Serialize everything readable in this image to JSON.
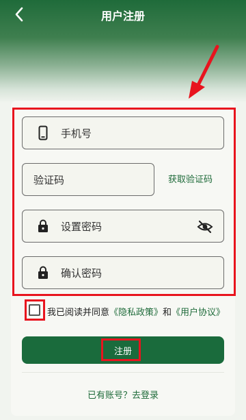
{
  "header": {
    "title": "用户注册",
    "back_icon": "chevron-left-icon"
  },
  "form": {
    "phone_placeholder": "手机号",
    "code_placeholder": "验证码",
    "get_code_label": "获取验证码",
    "password_placeholder": "设置密码",
    "confirm_placeholder": "确认密码"
  },
  "agreement": {
    "prefix": "我已阅读并同意",
    "privacy_link": "《隐私政策》",
    "conjunction": "和",
    "terms_link": "《用户协议》",
    "checked": false
  },
  "register_button": {
    "label": "注册"
  },
  "login_link": {
    "label": "已有账号？去登录"
  },
  "colors": {
    "accent": "#1a6b3c",
    "highlight": "#e8141e"
  }
}
